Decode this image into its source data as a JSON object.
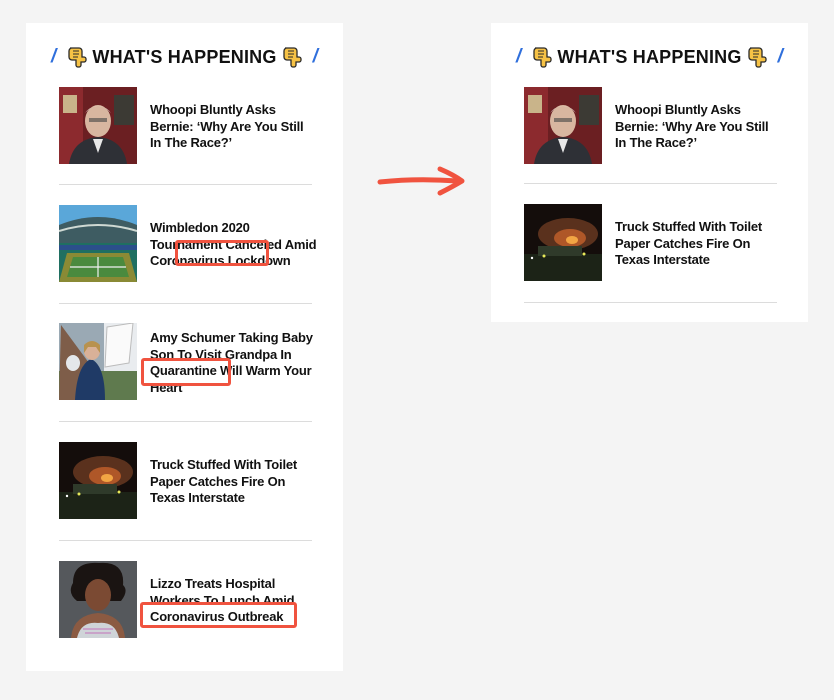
{
  "colors": {
    "page_bg": "#f4f4f4",
    "panel_bg": "#ffffff",
    "slash_accent": "#2f6fdc",
    "annotation_red": "#f0533f",
    "divider": "#dcdcdc"
  },
  "widget_title": "WHAT'S HAPPENING",
  "slash_char": "/",
  "icons": {
    "title_icon": "pointing-down-hand-icon",
    "arrow": "right-arrow-icon"
  },
  "left_panel": {
    "items": [
      {
        "headline": "Whoopi Bluntly Asks Bernie: ‘Why Are You Still In The Race?’",
        "thumb": "man-in-suit-video-call-thumbnail"
      },
      {
        "headline": "Wimbledon 2020 Tournament Canceled Amid Coronavirus Lockdown",
        "thumb": "tennis-stadium-thumbnail"
      },
      {
        "headline": "Amy Schumer Taking Baby Son To Visit Grandpa In Quarantine Will Warm Your Heart",
        "thumb": "woman-holding-baby-thumbnail"
      },
      {
        "headline": "Truck Stuffed With Toilet Paper Catches Fire On Texas Interstate",
        "thumb": "truck-fire-night-thumbnail"
      },
      {
        "headline": "Lizzo Treats Hospital Workers To Lunch Amid Coronavirus Outbreak",
        "thumb": "lizzo-portrait-thumbnail"
      }
    ]
  },
  "right_panel": {
    "items": [
      {
        "headline": "Whoopi Bluntly Asks Bernie: ‘Why Are You Still In The Race?’",
        "thumb": "man-in-suit-video-call-thumbnail"
      },
      {
        "headline": "Truck Stuffed With Toilet Paper Catches Fire On Texas Interstate",
        "thumb": "truck-fire-night-thumbnail"
      }
    ]
  },
  "annotations": {
    "highlighted_terms": [
      "Coronavirus",
      "Quarantine",
      "Coronavirus Outbreak"
    ]
  }
}
